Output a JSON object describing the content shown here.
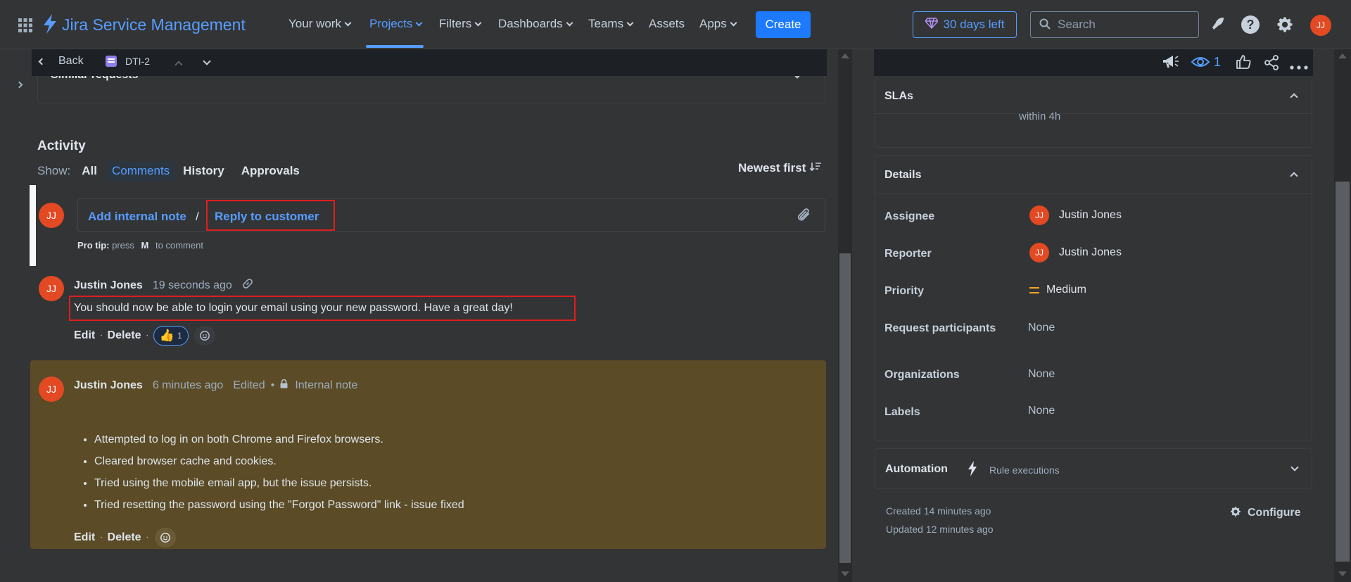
{
  "nav": {
    "product": "Jira Service Management",
    "links": [
      {
        "label": "Your work",
        "dropdown": true
      },
      {
        "label": "Projects",
        "dropdown": true,
        "active": true
      },
      {
        "label": "Filters",
        "dropdown": true
      },
      {
        "label": "Dashboards",
        "dropdown": true
      },
      {
        "label": "Teams",
        "dropdown": true
      },
      {
        "label": "Assets",
        "dropdown": false
      },
      {
        "label": "Apps",
        "dropdown": true
      }
    ],
    "create": "Create",
    "trial": "30 days left",
    "search_placeholder": "Search",
    "user_initials": "JJ"
  },
  "issue_bar": {
    "back": "Back",
    "issue_key": "DTI-2"
  },
  "similar": "Similar requests",
  "activity": {
    "title": "Activity",
    "show_label": "Show:",
    "filters": [
      "All",
      "Comments",
      "History",
      "Approvals"
    ],
    "active_filter": "Comments",
    "sort": "Newest first",
    "editor": {
      "add_internal": "Add internal note",
      "separator": "/",
      "reply": "Reply to customer",
      "pro_tip_label": "Pro tip:",
      "pro_tip_press": "press",
      "pro_tip_key": "M",
      "pro_tip_rest": "to comment"
    },
    "comment1": {
      "author": "Justin Jones",
      "time": "19 seconds ago",
      "text": "You should now be able to login your email using your new password. Have a great day!",
      "edit": "Edit",
      "delete": "Delete",
      "reaction_count": "1"
    },
    "comment2": {
      "author": "Justin Jones",
      "time": "6 minutes ago",
      "edited": "Edited",
      "tag": "Internal note",
      "bullets": [
        "Attempted to log in on both Chrome and Firefox browsers.",
        "Cleared browser cache and cookies.",
        "Tried using the mobile email app, but the issue persists.",
        "Tried resetting the password using the \"Forgot Password\" link - issue fixed"
      ],
      "edit": "Edit",
      "delete": "Delete"
    }
  },
  "right": {
    "watch_count": "1",
    "slas_title": "SLAs",
    "sla_partial": "within 4h",
    "details_title": "Details",
    "fields": {
      "assignee_label": "Assignee",
      "assignee": "Justin Jones",
      "reporter_label": "Reporter",
      "reporter": "Justin Jones",
      "priority_label": "Priority",
      "priority": "Medium",
      "participants_label": "Request participants",
      "participants": "None",
      "orgs_label": "Organizations",
      "orgs": "None",
      "labels_label": "Labels",
      "labels": "None"
    },
    "automation_title": "Automation",
    "rule_exec": "Rule executions",
    "created": "Created 14 minutes ago",
    "updated": "Updated 12 minutes ago",
    "configure": "Configure"
  },
  "colors": {
    "accent": "#579dff",
    "create_button": "#1d7afc",
    "internal_note_bg": "#5b4b26",
    "avatar": "#e34922",
    "highlight_box": "#e01e1e",
    "priority_medium": "#f5a623"
  }
}
